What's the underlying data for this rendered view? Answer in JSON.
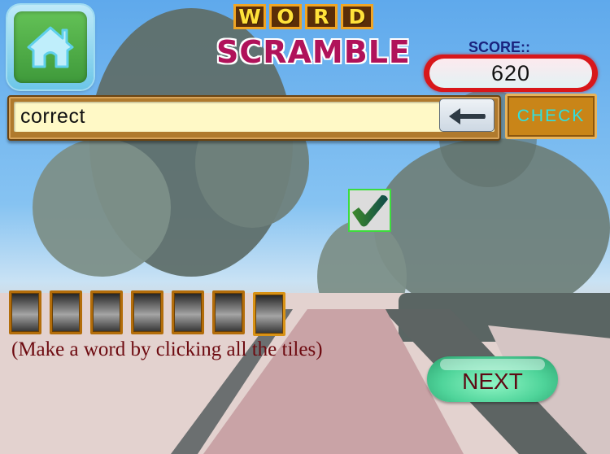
{
  "title": {
    "word_letters": [
      "W",
      "O",
      "R",
      "D"
    ],
    "scramble": "SCRAMBLE"
  },
  "home_button": {
    "icon": "home-icon"
  },
  "score": {
    "label": "SCORE::",
    "value": "620"
  },
  "answer": {
    "value": "correct"
  },
  "backspace": {
    "icon": "left-arrow-icon"
  },
  "check_button": {
    "label": "CHECK"
  },
  "result_indicator": {
    "icon": "checkmark-icon",
    "status": "correct"
  },
  "tiles": {
    "count": 7,
    "letters": [
      "",
      "",
      "",
      "",
      "",
      "",
      ""
    ]
  },
  "hint": "(Make a word by clicking all the tiles)",
  "next_button": {
    "label": "NEXT"
  },
  "colors": {
    "title_word_text": "#ffe23a",
    "title_scramble_text": "#b0125a",
    "score_label": "#1a237e",
    "score_pill_border": "#d8171b",
    "check_text": "#2fe0e0",
    "check_bg": "#c98518",
    "next_bg": "#4fd49a",
    "hint_text": "#6d0a10"
  }
}
